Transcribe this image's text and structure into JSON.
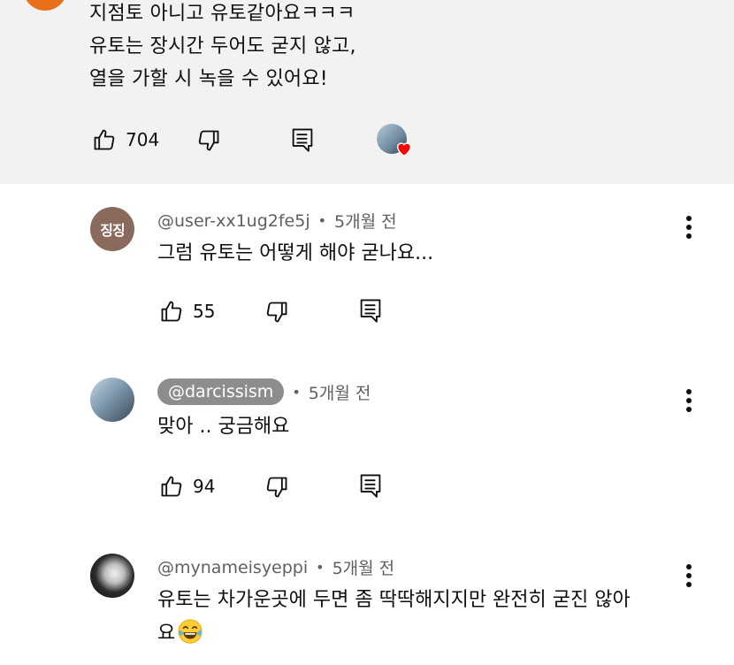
{
  "parent": {
    "text_lines": [
      "지점토 아니고 유토같아요ㅋㅋㅋ",
      "유토는 장시간 두어도 굳지 않고,",
      "열을 가할 시 녹을 수 있어요!"
    ],
    "likes": "704",
    "icons": {
      "like": "thumbs-up-icon",
      "dislike": "thumbs-down-icon",
      "reply": "reply-icon",
      "creator_heart": "heart-icon"
    },
    "colors": {
      "background": "#f2f2f2",
      "avatar": "#e8701a",
      "heart": "#ff0000"
    }
  },
  "replies": [
    {
      "avatar_text": "징징",
      "handle": "@user-xx1ug2fe5j",
      "time": "5개월 전",
      "text_lines": [
        "그럼 유토는 어떻게 해야 굳나요..."
      ],
      "likes": "55",
      "avatar_color": "#8b6a5e"
    },
    {
      "handle": "@darcissism",
      "handle_highlighted": true,
      "time": "5개월 전",
      "text_lines": [
        "맞아 .. 궁금해요"
      ],
      "likes": "94"
    },
    {
      "handle": "@mynameisyeppi",
      "time": "5개월 전",
      "text_lines": [
        "유토는 차가운곳에 두면 좀 딱딱해지지만 완전히 굳진 않아",
        "요"
      ],
      "emoji": "laughing-tears-emoji"
    }
  ],
  "separator_dot": "•"
}
